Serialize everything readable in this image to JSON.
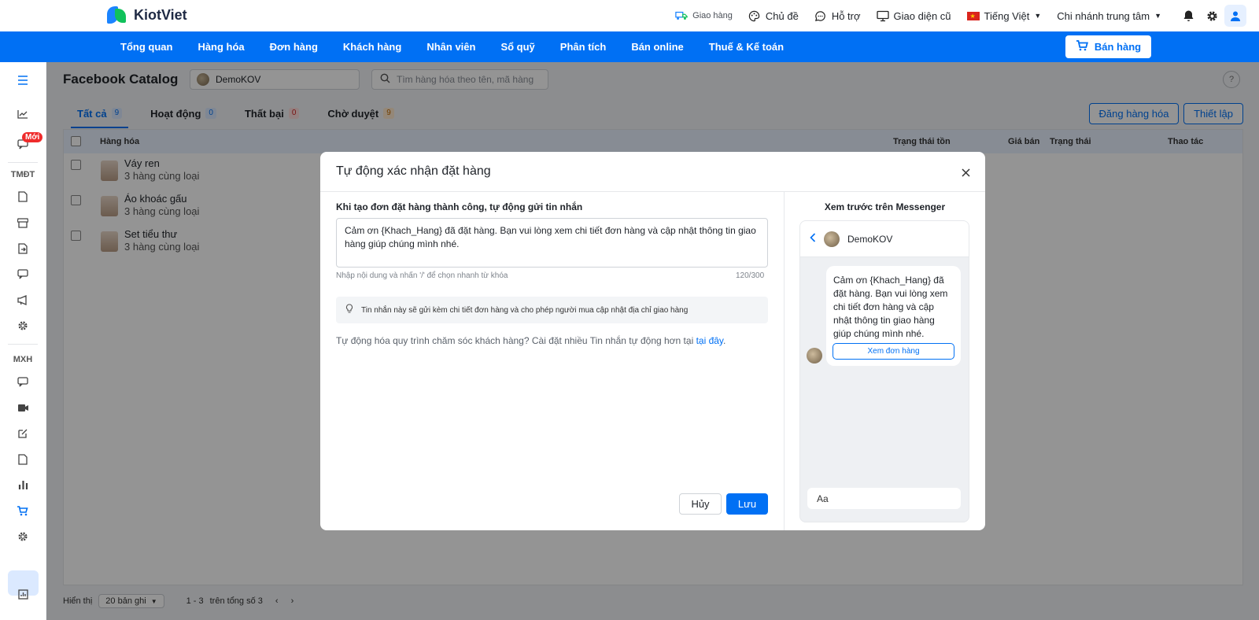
{
  "app": {
    "logo_text": "KiotViet"
  },
  "topbar": {
    "delivery": "Giao hàng",
    "theme": "Chủ đề",
    "support": "Hỗ trợ",
    "old_ui": "Giao diện cũ",
    "language": "Tiếng Việt",
    "branch": "Chi nhánh trung tâm"
  },
  "nav": {
    "items": [
      "Tổng quan",
      "Hàng hóa",
      "Đơn hàng",
      "Khách hàng",
      "Nhân viên",
      "Sổ quỹ",
      "Phân tích",
      "Bán online",
      "Thuế & Kế toán"
    ],
    "sell_button": "Bán hàng"
  },
  "sidebar": {
    "new_badge": "Mới",
    "section_ecommerce": "TMĐT",
    "section_social": "MXH"
  },
  "page": {
    "title": "Facebook Catalog",
    "page_select": "DemoKOV",
    "search_placeholder": "Tìm hàng hóa theo tên, mã hàng",
    "help": "?",
    "tabs": [
      {
        "label": "Tất cả",
        "count": "9"
      },
      {
        "label": "Hoạt động",
        "count": "0"
      },
      {
        "label": "Thất bại",
        "count": "0"
      },
      {
        "label": "Chờ duyệt",
        "count": "9"
      }
    ],
    "post_button": "Đăng hàng hóa",
    "settings_button": "Thiết lập",
    "columns": {
      "product": "Hàng hóa",
      "stock_status": "Trạng thái tồn",
      "price": "Giá bán",
      "status": "Trạng thái",
      "actions": "Thao tác"
    },
    "rows": [
      {
        "name": "Váy ren",
        "sub": "3 hàng cùng loại"
      },
      {
        "name": "Áo khoác gấu",
        "sub": "3 hàng cùng loại"
      },
      {
        "name": "Set tiểu thư",
        "sub": "3 hàng cùng loại"
      }
    ],
    "pager": {
      "show_label": "Hiển thị",
      "per_page": "20 bản ghi",
      "range": "1 - 3",
      "total": "trên tổng số 3"
    }
  },
  "modal": {
    "title": "Tự động xác nhận đặt hàng",
    "field_label": "Khi tạo đơn đặt hàng thành công, tự động gửi tin nhắn",
    "message": "Cảm ơn {Khach_Hang} đã đặt hàng. Bạn vui lòng xem chi tiết đơn hàng và cập nhật thông tin giao hàng giúp chúng mình nhé.",
    "hint": "Nhập nội dung và nhấn '/' để chọn nhanh từ khóa",
    "char_count": "120/300",
    "info": "Tin nhắn này sẽ gửi kèm chi tiết đơn hàng và cho phép người mua cập nhật địa chỉ giao hàng",
    "automate_text": "Tự động hóa quy trình chăm sóc khách hàng? Cài đặt nhiều Tin nhắn tự động hơn tại",
    "automate_link": "tại đây",
    "cancel": "Hủy",
    "save": "Lưu",
    "preview_title": "Xem trước trên Messenger",
    "preview_page": "DemoKOV",
    "preview_button": "Xem đơn hàng",
    "preview_input": "Aa"
  },
  "colors": {
    "primary": "#0070f4",
    "success": "#10c15b",
    "danger": "#ef2b2b"
  }
}
